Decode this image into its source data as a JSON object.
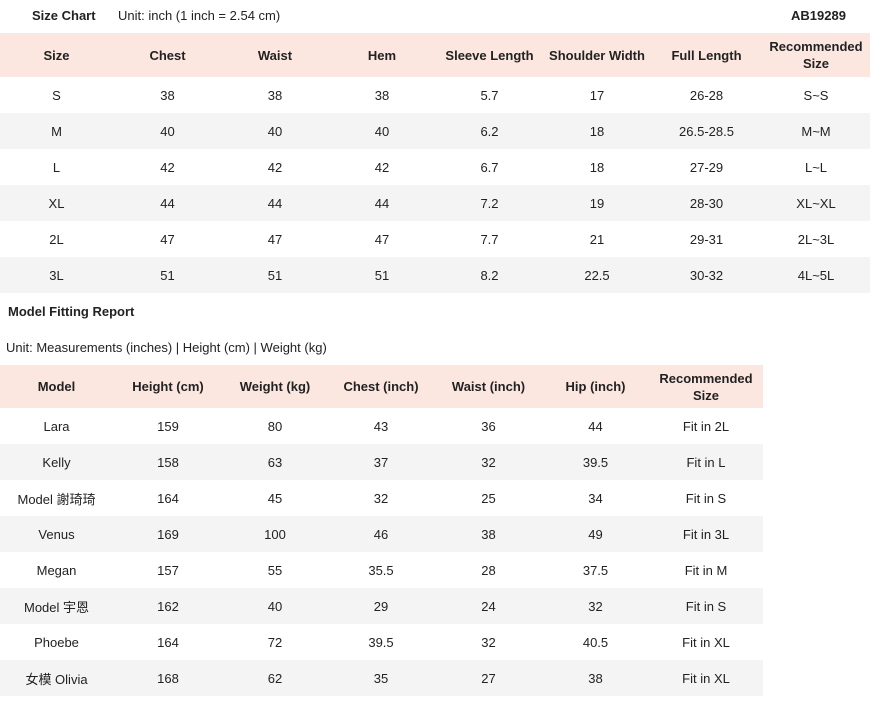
{
  "header": {
    "title": "Size Chart",
    "unit_note": "Unit: inch (1 inch = 2.54 cm)",
    "product_code": "AB19289"
  },
  "size_chart": {
    "columns": [
      "Size",
      "Chest",
      "Waist",
      "Hem",
      "Sleeve Length",
      "Shoulder Width",
      "Full Length",
      "Recommended Size"
    ],
    "rows": [
      [
        "S",
        "38",
        "38",
        "38",
        "5.7",
        "17",
        "26-28",
        "S~S"
      ],
      [
        "M",
        "40",
        "40",
        "40",
        "6.2",
        "18",
        "26.5-28.5",
        "M~M"
      ],
      [
        "L",
        "42",
        "42",
        "42",
        "6.7",
        "18",
        "27-29",
        "L~L"
      ],
      [
        "XL",
        "44",
        "44",
        "44",
        "7.2",
        "19",
        "28-30",
        "XL~XL"
      ],
      [
        "2L",
        "47",
        "47",
        "47",
        "7.7",
        "21",
        "29-31",
        "2L~3L"
      ],
      [
        "3L",
        "51",
        "51",
        "51",
        "8.2",
        "22.5",
        "30-32",
        "4L~5L"
      ]
    ]
  },
  "model_report": {
    "title": "Model Fitting Report",
    "unit_note": "Unit: Measurements (inches) | Height (cm) | Weight (kg)",
    "columns": [
      "Model",
      "Height (cm)",
      "Weight (kg)",
      "Chest (inch)",
      "Waist (inch)",
      "Hip (inch)",
      "Recommended Size"
    ],
    "rows": [
      [
        "Lara",
        "159",
        "80",
        "43",
        "36",
        "44",
        "Fit in 2L"
      ],
      [
        "Kelly",
        "158",
        "63",
        "37",
        "32",
        "39.5",
        "Fit in L"
      ],
      [
        "Model 謝琦琦",
        "164",
        "45",
        "32",
        "25",
        "34",
        "Fit in S"
      ],
      [
        "Venus",
        "169",
        "100",
        "46",
        "38",
        "49",
        "Fit in 3L"
      ],
      [
        "Megan",
        "157",
        "55",
        "35.5",
        "28",
        "37.5",
        "Fit in M"
      ],
      [
        "Model 宇恩",
        "162",
        "40",
        "29",
        "24",
        "32",
        "Fit in S"
      ],
      [
        "Phoebe",
        "164",
        "72",
        "39.5",
        "32",
        "40.5",
        "Fit in XL"
      ],
      [
        "女模 Olivia",
        "168",
        "62",
        "35",
        "27",
        "38",
        "Fit in XL"
      ]
    ]
  }
}
